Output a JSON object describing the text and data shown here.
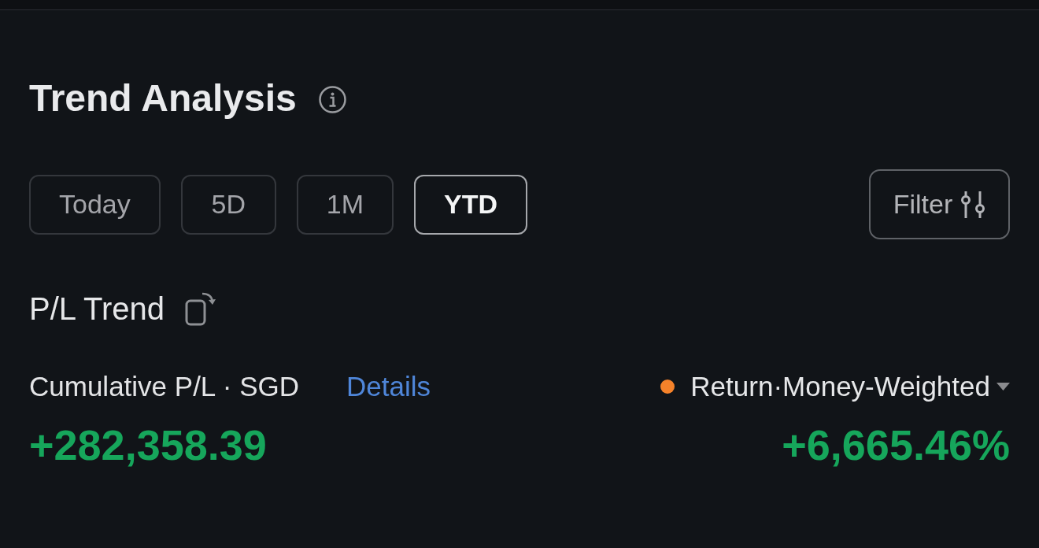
{
  "section": {
    "title": "Trend Analysis"
  },
  "periods": [
    {
      "label": "Today",
      "selected": false
    },
    {
      "label": "5D",
      "selected": false
    },
    {
      "label": "1M",
      "selected": false
    },
    {
      "label": "YTD",
      "selected": true
    }
  ],
  "filter_button": {
    "label": "Filter"
  },
  "pl_trend": {
    "title": "P/L Trend",
    "metric_label": "Cumulative P/L · SGD",
    "details_link": "Details",
    "value": "+282,358.39",
    "return_selector": {
      "label": "Return·Money-Weighted",
      "color": "#f5822a"
    },
    "return_value": "+6,665.46%"
  }
}
